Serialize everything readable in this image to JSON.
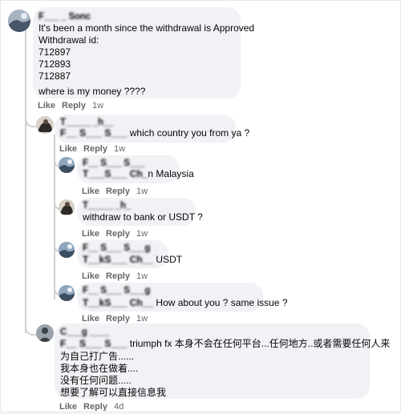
{
  "comments": [
    {
      "author": "F___ _ Sonc",
      "lines": [
        "It's been a month since the withdrawal is Approved",
        "Withdrawal id:",
        "712897",
        "712893",
        "712887",
        "",
        "where is my money ????"
      ],
      "like": "Like",
      "reply": "Reply",
      "time": "1w"
    },
    {
      "author": "T_____ _h__",
      "mention": "F__ S___ S___",
      "text": "which country you from ya ?",
      "like": "Like",
      "reply": "Reply",
      "time": "1w"
    },
    {
      "author": "F__ S___ S___",
      "mention": "T___S___ Ch_",
      "text": "n Malaysia",
      "like": "Like",
      "reply": "Reply",
      "time": "1w"
    },
    {
      "author": "T_____ _h_",
      "text": "withdraw to bank or USDT ?",
      "like": "Like",
      "reply": "Reply",
      "time": "1w"
    },
    {
      "author": "F__ S___ S___g",
      "mention": "T__kS___ Ch__",
      "text": "USDT",
      "like": "Like",
      "reply": "Reply",
      "time": "1w"
    },
    {
      "author": "F__ S___ S___g",
      "mention": "T__kS___ Ch__",
      "text": "How about you ? same issue ?",
      "like": "Like",
      "reply": "Reply",
      "time": "1w"
    },
    {
      "author": "C___g ____",
      "mention": "F__ S___ S___",
      "lines": [
        "triumph fx 本身不会在任何平台...任何地方..或者需要任何人来",
        "为自己打广告......",
        "我本身也在做着....",
        "没有任何问题.....",
        "想要了解可以直接信息我"
      ],
      "like": "Like",
      "reply": "Reply",
      "time": "4d"
    }
  ]
}
